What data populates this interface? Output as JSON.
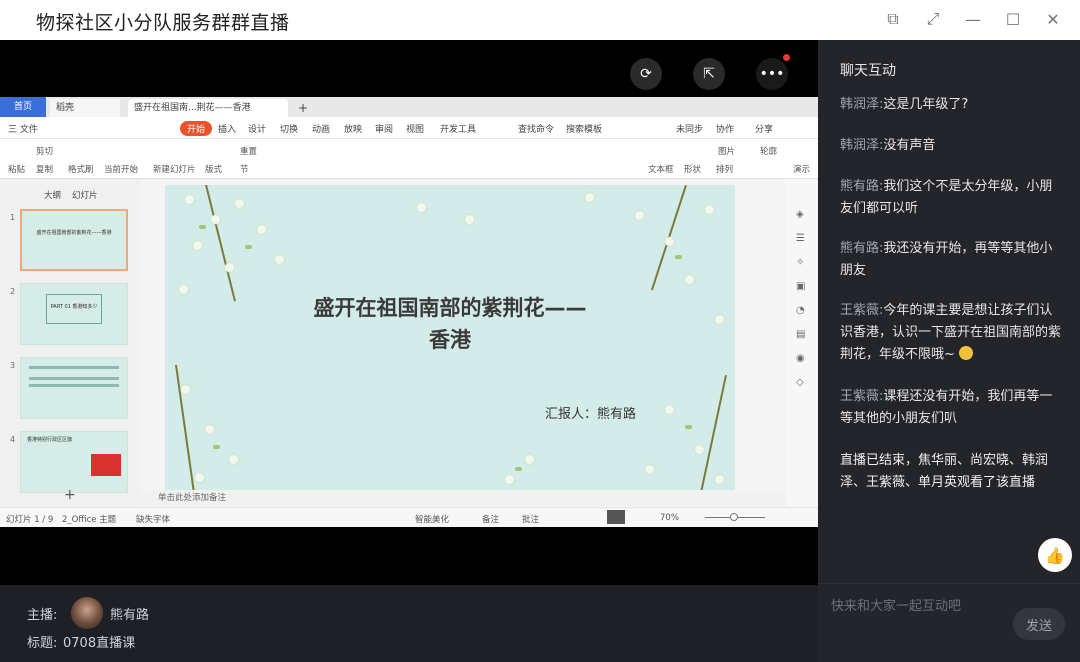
{
  "window": {
    "title": "物探社区小分队服务群群直播",
    "controls": {
      "pip": "⧉",
      "fullscreen": "⤢",
      "minimize": "—",
      "maximize": "☐",
      "close": "✕"
    }
  },
  "video_toolbar": {
    "rotate_icon": "⟳",
    "share_icon": "⇱",
    "more_icon": "•••"
  },
  "wps": {
    "tabs": {
      "home": "首页",
      "doc": "稻壳",
      "active": "盛开在祖国南...荆花——香港",
      "plus": "+"
    },
    "menu": [
      "三 文件",
      "开始",
      "插入",
      "设计",
      "切换",
      "动画",
      "放映",
      "审阅",
      "视图",
      "开发工具",
      "查找命令",
      "搜索模板",
      "未同步",
      "协作",
      "分享"
    ],
    "ribbon": [
      "剪切",
      "粘贴",
      "复制",
      "格式刷",
      "当前开始",
      "新建幻灯片",
      "版式",
      "节",
      "重置",
      "文本框",
      "形状",
      "排列",
      "图片",
      "轮廓",
      "演示"
    ],
    "left_tabs": {
      "outline": "大纲",
      "slides": "幻灯片"
    },
    "thumbs": [
      {
        "num": "1",
        "text": "盛开在祖国南部的紫荆花——香港"
      },
      {
        "num": "2",
        "text": "PART 01 香港知多少"
      },
      {
        "num": "3",
        "text": ""
      },
      {
        "num": "4",
        "text": "香港特别行政区区旗"
      }
    ],
    "add_slide": "+",
    "slide": {
      "title_line1": "盛开在祖国南部的紫荆花——",
      "title_line2": "香港",
      "reporter": "汇报人：熊有路"
    },
    "notes_placeholder": "单击此处添加备注",
    "status": {
      "page": "幻灯片 1 / 9",
      "theme": "2_Office 主题",
      "font": "缺失字体",
      "beautify": "智能美化",
      "notes": "备注",
      "comment": "批注",
      "zoom": "70%"
    }
  },
  "info": {
    "host_label": "主播:",
    "host_name": "熊有路",
    "title_label": "标题:",
    "title_value": "0708直播课"
  },
  "chat": {
    "header": "聊天互动",
    "messages": [
      {
        "name": "韩润泽:",
        "text": "这是几年级了?"
      },
      {
        "name": "韩润泽:",
        "text": "没有声音"
      },
      {
        "name": "熊有路:",
        "text": "我们这个不是太分年级，小朋友们都可以听"
      },
      {
        "name": "熊有路:",
        "text": "我还没有开始，再等等其他小朋友"
      },
      {
        "name": "王紫薇:",
        "text": "今年的课主要是想让孩子们认识香港，认识一下盛开在祖国南部的紫荆花，年级不限哦~"
      },
      {
        "name": "王紫薇:",
        "text": "课程还没有开始，我们再等一等其他的小朋友们叭"
      }
    ],
    "system_message": "直播已结束，焦华丽、尚宏晓、韩润泽、王紫薇、单月英观看了该直播",
    "like_icon": "👍",
    "input_placeholder": "快来和大家一起互动吧",
    "send_label": "发送"
  }
}
